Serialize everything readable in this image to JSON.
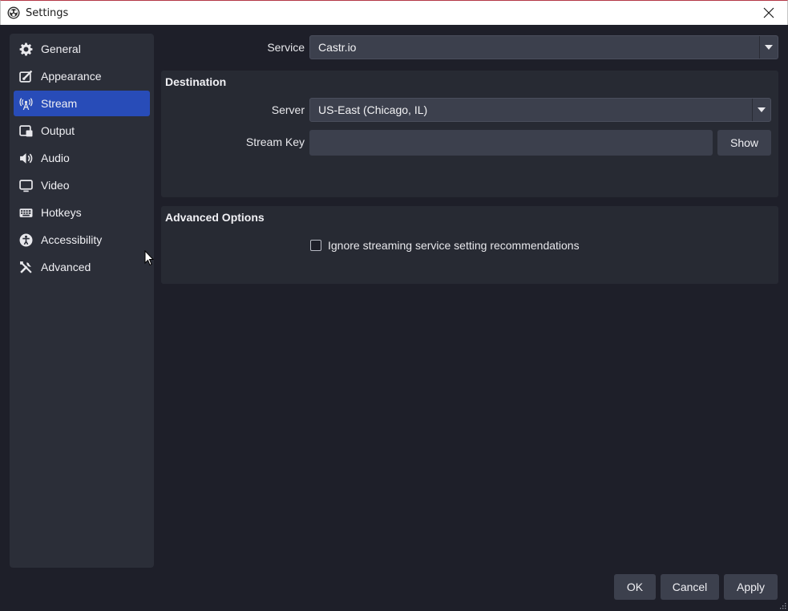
{
  "window": {
    "title": "Settings",
    "close_glyph": "✕"
  },
  "sidebar": {
    "items": [
      {
        "label": "General",
        "icon": "gear-icon"
      },
      {
        "label": "Appearance",
        "icon": "brush-icon"
      },
      {
        "label": "Stream",
        "icon": "antenna-icon",
        "active": true
      },
      {
        "label": "Output",
        "icon": "output-icon"
      },
      {
        "label": "Audio",
        "icon": "speaker-icon"
      },
      {
        "label": "Video",
        "icon": "monitor-icon"
      },
      {
        "label": "Hotkeys",
        "icon": "keyboard-icon"
      },
      {
        "label": "Accessibility",
        "icon": "accessibility-icon"
      },
      {
        "label": "Advanced",
        "icon": "wrench-icon"
      }
    ]
  },
  "service": {
    "label": "Service",
    "value": "Castr.io"
  },
  "destination": {
    "title": "Destination",
    "server_label": "Server",
    "server_value": "US-East (Chicago, IL)",
    "stream_key_label": "Stream Key",
    "stream_key_value": "",
    "show_button": "Show"
  },
  "advanced_options": {
    "title": "Advanced Options",
    "ignore_recommendations_label": "Ignore streaming service setting recommendations",
    "ignore_recommendations_checked": false
  },
  "footer": {
    "ok": "OK",
    "cancel": "Cancel",
    "apply": "Apply"
  },
  "colors": {
    "background": "#1e1f29",
    "sidebar": "#2b2e38",
    "accent": "#284cb8",
    "control": "#3c404d"
  }
}
